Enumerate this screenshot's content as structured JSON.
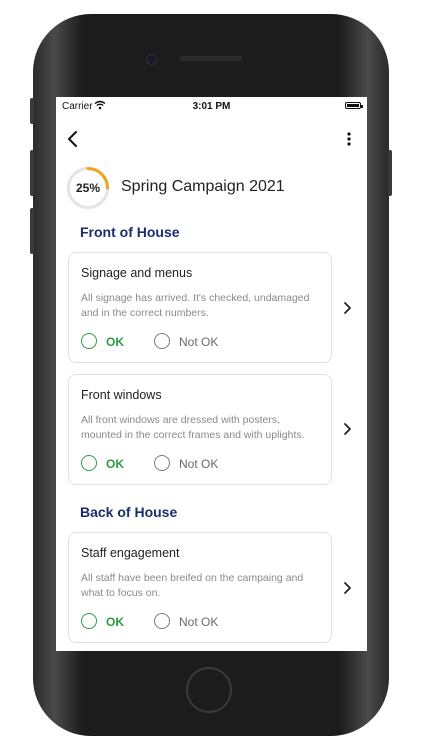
{
  "status_bar": {
    "carrier": "Carrier",
    "time": "3:01 PM"
  },
  "header": {
    "back_icon": "chevron-left-icon",
    "more_icon": "more-vertical-icon"
  },
  "campaign": {
    "progress_label": "25%",
    "progress_fraction": 0.25,
    "title": "Spring Campaign 2021"
  },
  "sections": [
    {
      "title": "Front of House",
      "items": [
        {
          "title": "Signage and menus",
          "description": "All signage has arrived. It's checked, undamaged and in the correct numbers.",
          "ok_label": "OK",
          "not_ok_label": "Not OK"
        },
        {
          "title": "Front windows",
          "description": "All front windows are dressed with posters, mounted in the correct frames and with uplights.",
          "ok_label": "OK",
          "not_ok_label": "Not OK"
        }
      ]
    },
    {
      "title": "Back of House",
      "items": [
        {
          "title": "Staff engagement",
          "description": "All staff have been breifed on the campaing and what to focus on.",
          "ok_label": "OK",
          "not_ok_label": "Not OK"
        }
      ]
    }
  ],
  "colors": {
    "accent_orange": "#f2a21b",
    "ok_green": "#2e9b46",
    "section_navy": "#1a2e6b"
  }
}
